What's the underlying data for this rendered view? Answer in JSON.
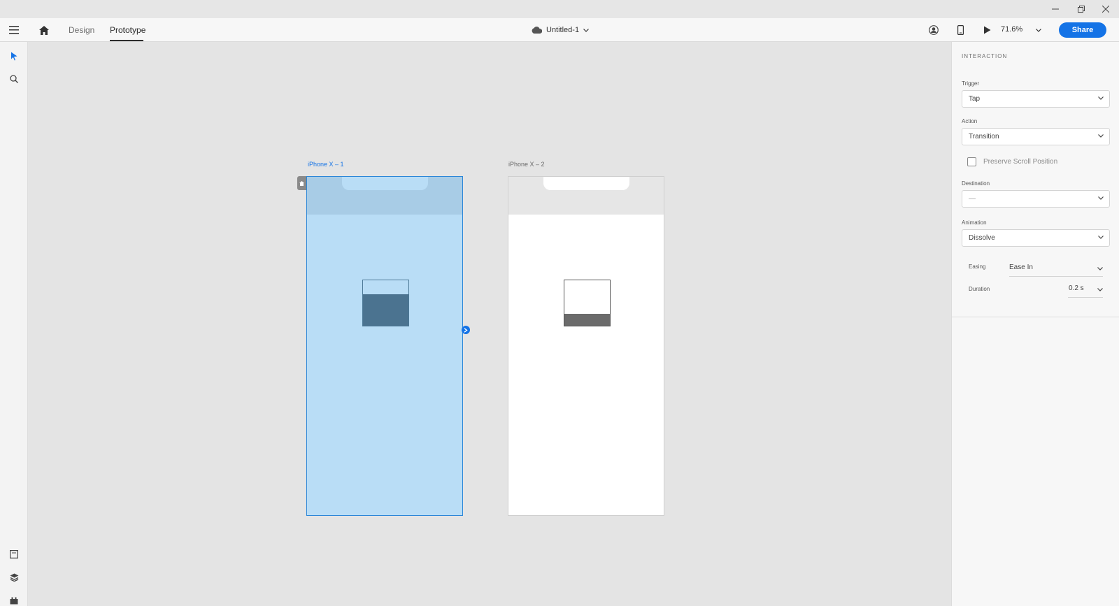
{
  "toolbar": {
    "tabs": [
      "Design",
      "Prototype"
    ],
    "active_tab": "Prototype",
    "document_title": "Untitled-1",
    "zoom": "71.6%",
    "share_label": "Share"
  },
  "canvas": {
    "artboards": [
      {
        "label": "iPhone X – 1",
        "selected": true
      },
      {
        "label": "iPhone X –  2",
        "selected": false
      }
    ]
  },
  "panel": {
    "title": "INTERACTION",
    "trigger": {
      "label": "Trigger",
      "value": "Tap"
    },
    "action": {
      "label": "Action",
      "value": "Transition"
    },
    "preserve_scroll": {
      "label": "Preserve Scroll Position",
      "checked": false
    },
    "destination": {
      "label": "Destination",
      "value": "—"
    },
    "animation": {
      "label": "Animation",
      "value": "Dissolve"
    },
    "easing": {
      "label": "Easing",
      "value": "Ease In"
    },
    "duration": {
      "label": "Duration",
      "value": "0.2 s"
    }
  },
  "colors": {
    "accent": "#1473e6",
    "selected_artboard": "#b9ddf6"
  }
}
